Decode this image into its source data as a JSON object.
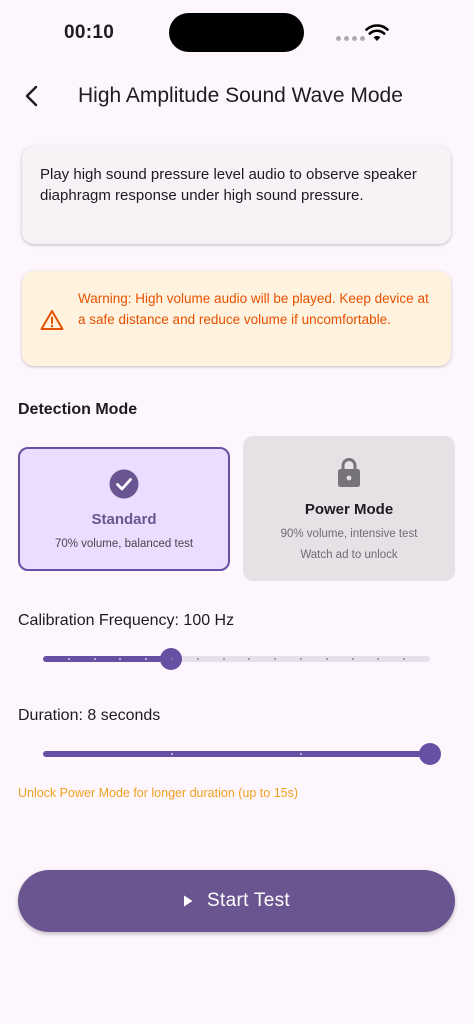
{
  "status_bar": {
    "time": "00:10"
  },
  "header": {
    "title": "High Amplitude Sound Wave Mode"
  },
  "info": {
    "text": "Play high sound pressure level audio to observe speaker diaphragm response under high sound pressure."
  },
  "warning": {
    "text": "Warning: High volume audio will be played. Keep device at a safe distance and reduce volume if uncomfortable."
  },
  "detection": {
    "label": "Detection Mode",
    "standard": {
      "title": "Standard",
      "desc": "70% volume, balanced test",
      "selected": true
    },
    "power": {
      "title": "Power Mode",
      "desc": "90% volume, intensive test",
      "unlock": "Watch ad to unlock",
      "locked": true
    }
  },
  "frequency": {
    "label": "Calibration Frequency: 100 Hz",
    "value_fraction": 0.33,
    "divisions": 15
  },
  "duration": {
    "label": "Duration: 8 seconds",
    "value_fraction": 1.0,
    "divisions": 3
  },
  "duration_hint": "Unlock Power Mode for longer duration (up to 15s)",
  "start_button": {
    "label": "Start Test"
  },
  "colors": {
    "primary": "#6750a4",
    "warning": "#e65100",
    "hint": "#f0a020"
  }
}
